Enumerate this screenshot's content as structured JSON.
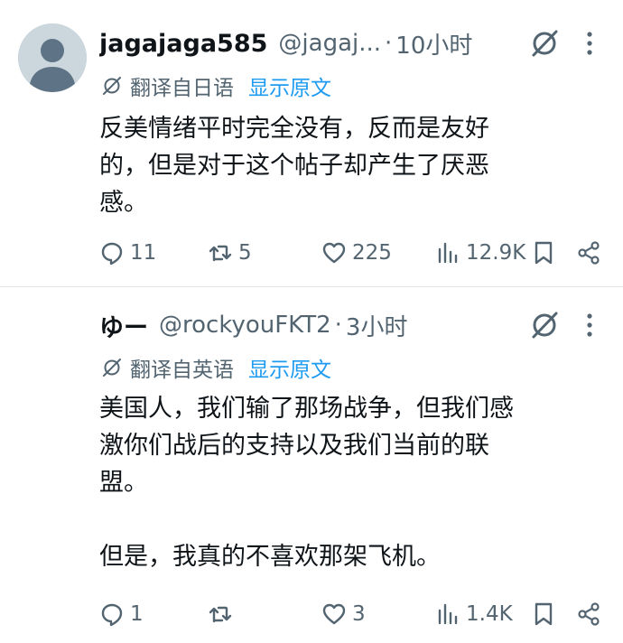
{
  "tweets": [
    {
      "display_name": "jagajaga585",
      "handle": "@jagaj...",
      "separator": "·",
      "time": "10小时",
      "translate_label": "翻译自日语",
      "show_original": "显示原文",
      "body": [
        "反美情绪平时完全没有，反而是友好",
        "的，但是对于这个帖子却产生了厌恶",
        "感。"
      ],
      "stats": {
        "replies": "11",
        "retweets": "5",
        "likes": "225",
        "views": "12.9K"
      }
    },
    {
      "display_name": "ゆー",
      "handle": "@rockyouFKT2",
      "separator": "·",
      "time": "3小时",
      "translate_label": "翻译自英语",
      "show_original": "显示原文",
      "body": [
        "美国人，我们输了那场战争，但我们感",
        "激你们战后的支持以及我们当前的联",
        "盟。",
        "",
        "但是，我真的不喜欢那架飞机。"
      ],
      "stats": {
        "replies": "1",
        "retweets": "",
        "likes": "3",
        "views": "1.4K"
      }
    }
  ],
  "colors": {
    "text_primary": "#0f1419",
    "text_secondary": "#536471",
    "link": "#1d9bf0",
    "divider": "#e3e6e9",
    "avatar_bg": "#ccd6dd"
  },
  "icons": [
    "reply-icon",
    "retweet-icon",
    "like-icon",
    "views-icon",
    "bookmark-icon",
    "share-icon",
    "grok-icon",
    "more-icon",
    "translate-icon"
  ]
}
